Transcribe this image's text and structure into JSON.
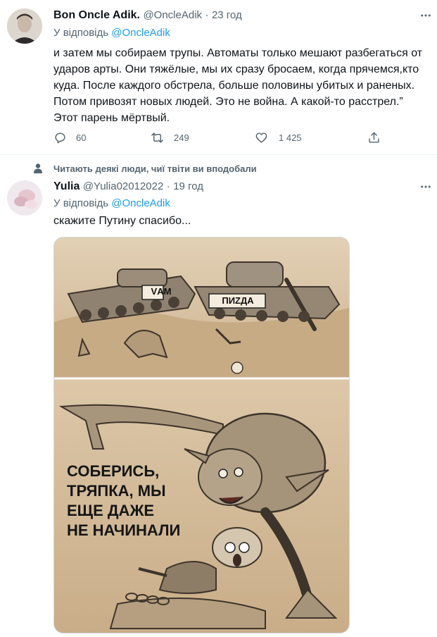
{
  "tweet1": {
    "author_name": "Bon Oncle Adik.",
    "handle": "@OncleAdik",
    "separator": "·",
    "time": "23 год",
    "reply_prefix": "У відповідь",
    "reply_to": "@OncleAdik",
    "text": "и затем мы собираем трупы. Автоматы только мешают разбегаться от ударов арты. Они тяжёлые, мы их сразу бросаем, когда прячемся,кто куда. После каждого обстрела, больше половины убитых и раненых. Потом привозят новых людей. Это не война. А какой-то расстрел.” Этот парень мёртвый.",
    "replies": "60",
    "retweets": "249",
    "likes": "1 425"
  },
  "social_context": "Читають деякі люди, чиї твіти ви вподобали",
  "tweet2": {
    "author_name": "Yulia",
    "handle": "@Yulia02012022",
    "separator": "·",
    "time": "19 год",
    "reply_prefix": "У відповідь",
    "reply_to": "@OncleAdik",
    "text": "скажите Путину спасибо...",
    "image_text": {
      "tank1_label": "VАМ",
      "tank2_label": "ПИZДА",
      "caption_line1": "СОБЕРИСЬ,",
      "caption_line2": "ТРЯПКА, МЫ",
      "caption_line3": "ЕЩЕ ДАЖЕ",
      "caption_line4": "НЕ НАЧИНАЛИ"
    }
  },
  "icons": {
    "more": "more-horizontal-icon",
    "reply": "reply-icon",
    "retweet": "retweet-icon",
    "like": "like-icon",
    "share": "share-icon",
    "person": "person-icon"
  },
  "colors": {
    "link": "#1d9bf0",
    "muted": "#536471",
    "text": "#0f1419",
    "divider": "#eff3f4",
    "sepia": "#d8c3a5"
  }
}
